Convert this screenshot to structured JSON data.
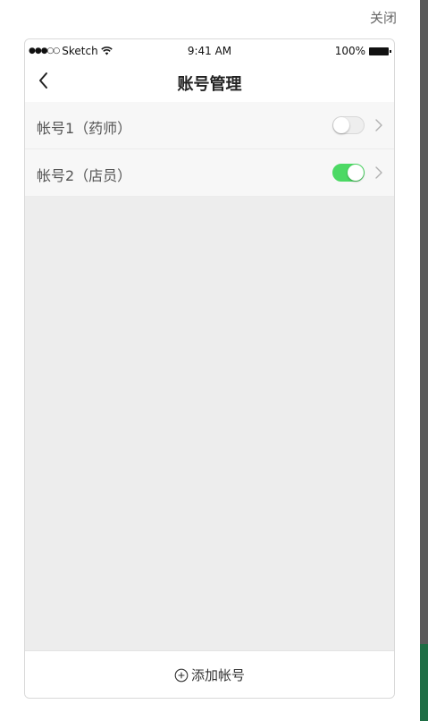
{
  "close_label": "关闭",
  "status_bar": {
    "carrier": "Sketch",
    "signal_dots": "●●●○○",
    "time": "9:41 AM",
    "battery": "100%"
  },
  "nav": {
    "title": "账号管理"
  },
  "accounts": [
    {
      "label": "帐号1（药师）",
      "enabled": false
    },
    {
      "label": "帐号2（店员）",
      "enabled": true
    }
  ],
  "footer": {
    "add_label": "添加帐号"
  },
  "colors": {
    "toggle_on": "#4cd964",
    "background": "#ededed"
  },
  "icons": {
    "back": "chevron-left-icon",
    "row_arrow": "chevron-right-icon",
    "add": "plus-circle-icon",
    "wifi": "wifi-icon",
    "battery": "battery-icon"
  }
}
